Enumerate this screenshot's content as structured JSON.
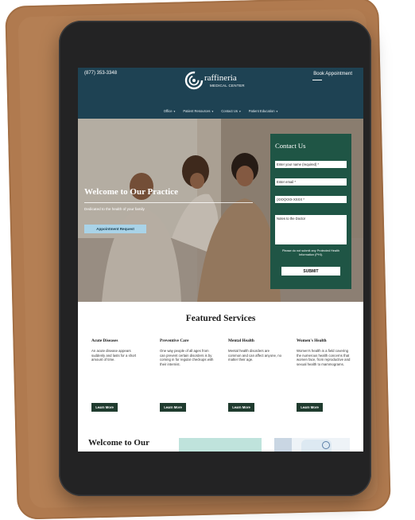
{
  "site": {
    "phone": "(877) 353-3348",
    "book_link": "Book Appointment",
    "logo": {
      "name": "raffineria",
      "tagline": "MEDICAL CENTER",
      "icon": "brand-c-swirl-icon"
    }
  },
  "nav": [
    {
      "label": "Office",
      "icon": "chevron-down-icon"
    },
    {
      "label": "Patient Resources",
      "icon": "chevron-down-icon"
    },
    {
      "label": "Contact Us",
      "icon": "chevron-down-icon"
    },
    {
      "label": "Patient Education",
      "icon": "chevron-down-icon"
    }
  ],
  "hero": {
    "title": "Welcome to Our Practice",
    "subtitle": "Dedicated to the health of your family",
    "button": "Appointment Request"
  },
  "contact_form": {
    "title": "Contact Us",
    "fields": [
      "Enter your name (required) *",
      "Enter email *",
      "(XXX)XXX-XXXX *",
      "Notes to the Doctor"
    ],
    "disclaimer": "Please do not submit any Protected Health Information (PHI).",
    "submit": "SUBMIT"
  },
  "services": {
    "title": "Featured Services",
    "items": [
      {
        "title": "Acute Diseases",
        "description": "An acute disease appears suddenly and lasts for a short amount of time.",
        "button": "Learn More"
      },
      {
        "title": "Preventive Care",
        "description": "One way people of all ages from can prevent certain disorders is by coming in for regular checkups with their internist.",
        "button": "Learn More"
      },
      {
        "title": "Mental Health",
        "description": "Mental health disorders are common and can affect anyone, no matter their age.",
        "button": "Learn More"
      },
      {
        "title": "Women's Health",
        "description": "Women's health is a field covering the numerous health concerns that women face, from reproductive and sexual health to mammograms.",
        "button": "Learn More"
      }
    ]
  },
  "welcome_section": {
    "title": "Welcome to Our"
  },
  "colors": {
    "header": "#1e4253",
    "contact_panel": "#1f5545",
    "appointment_button": "#a9d3e8",
    "service_button": "#1f3b2e",
    "mint_block": "#bfe3dc",
    "tablet_bezel": "#232324",
    "folio": "#b07a4f"
  }
}
